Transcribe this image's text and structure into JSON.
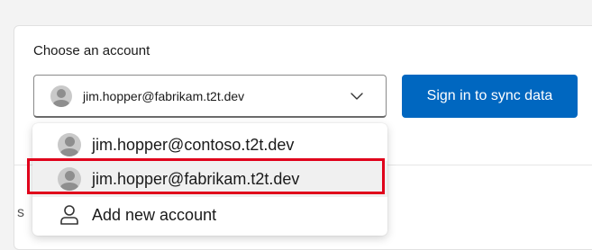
{
  "panel": {
    "heading": "Choose an account"
  },
  "select": {
    "selected_value": "jim.hopper@fabrikam.t2t.dev",
    "avatar_icon": "person-avatar-icon",
    "chevron_icon": "chevron-down-icon"
  },
  "sync_button": {
    "label": "Sign in to sync data",
    "color": "#0067c0"
  },
  "dropdown": {
    "items": [
      {
        "label": "jim.hopper@contoso.t2t.dev",
        "icon": "person-avatar-icon"
      },
      {
        "label": "jim.hopper@fabrikam.t2t.dev",
        "icon": "person-avatar-icon",
        "highlighted": true
      },
      {
        "label": "Add new account",
        "icon": "person-outline-icon"
      }
    ]
  },
  "annotation": {
    "highlight_color": "#e0001b"
  }
}
